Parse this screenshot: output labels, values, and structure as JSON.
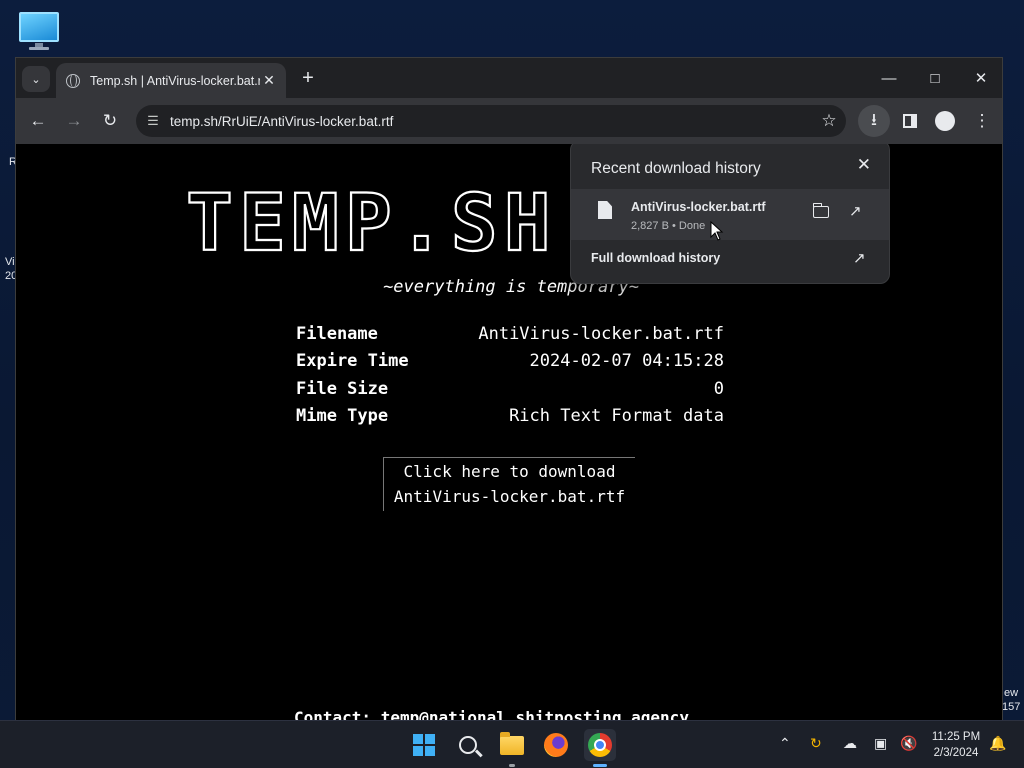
{
  "desktop": {
    "frag_left_top": "R",
    "frag_left_mid1": "Vi",
    "frag_left_mid2": "20",
    "frag_right_1": "ew",
    "frag_right_2": "157"
  },
  "browser": {
    "tab": {
      "title": "Temp.sh | AntiVirus-locker.bat.rtf"
    },
    "url": "temp.sh/RrUiE/AntiVirus-locker.bat.rtf"
  },
  "page": {
    "logo_text": "TEMP.SH",
    "tagline": "~everything is temporary~",
    "info": [
      {
        "label": "Filename",
        "value": "AntiVirus-locker.bat.rtf"
      },
      {
        "label": "Expire Time",
        "value": "2024-02-07 04:15:28"
      },
      {
        "label": "File Size",
        "value": "0"
      },
      {
        "label": "Mime Type",
        "value": "Rich Text Format data"
      }
    ],
    "download_line1": "Click here to download",
    "download_line2": "AntiVirus-locker.bat.rtf",
    "contact": "Contact: temp@national.shitposting.agency"
  },
  "downloads_panel": {
    "title": "Recent download history",
    "item": {
      "filename": "AntiVirus-locker.bat.rtf",
      "meta": "2,827 B • Done"
    },
    "full_history": "Full download history"
  },
  "taskbar": {
    "time": "11:25 PM",
    "date": "2/3/2024"
  },
  "colors": {
    "accent": "#3fb0f5",
    "page_bg": "#000000",
    "chrome_toolbar": "#35363a"
  }
}
